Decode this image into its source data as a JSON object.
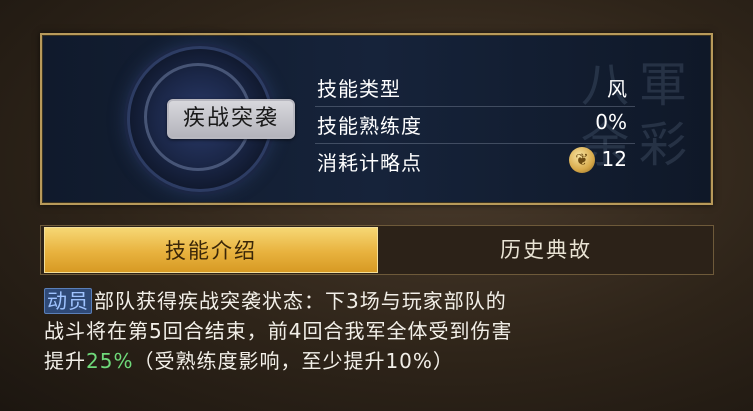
{
  "skill": {
    "name": "疾战突袭",
    "attributes": [
      {
        "label": "技能类型",
        "value": "风"
      },
      {
        "label": "技能熟练度",
        "value": "0%"
      },
      {
        "label": "消耗计略点",
        "value": "12",
        "icon": "strategy-point-icon"
      }
    ]
  },
  "tabs": [
    {
      "label": "技能介绍",
      "active": true
    },
    {
      "label": "历史典故",
      "active": false
    }
  ],
  "description": {
    "trigger": "动员",
    "part1": "部队获得疾战突袭状态：下3场与玩家部队的",
    "part2": "战斗将在第5回合结束，前4回合我军全体受到伤害",
    "part3_prefix": "提升",
    "highlight": "25%",
    "part3_suffix": "（受熟练度影响，至少提升10%）"
  },
  "colors": {
    "tab_active": "#e8b23e",
    "highlight": "#6fd97a",
    "trigger_tag": "#2f4a78",
    "panel_border": "#b89a5a"
  }
}
